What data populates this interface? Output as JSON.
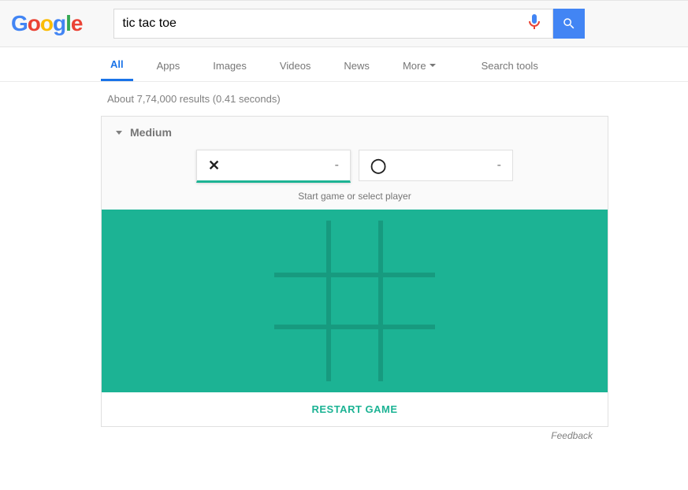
{
  "search": {
    "query": "tic tac toe"
  },
  "tabs": {
    "all": "All",
    "apps": "Apps",
    "images": "Images",
    "videos": "Videos",
    "news": "News",
    "more": "More",
    "search_tools": "Search tools"
  },
  "results_stats": "About 7,74,000 results (0.41 seconds)",
  "game": {
    "difficulty": "Medium",
    "player_x": {
      "mark": "✕",
      "score": "-"
    },
    "player_o": {
      "mark": "◯",
      "score": "-"
    },
    "hint": "Start game or select player",
    "restart": "RESTART GAME"
  },
  "feedback": "Feedback"
}
